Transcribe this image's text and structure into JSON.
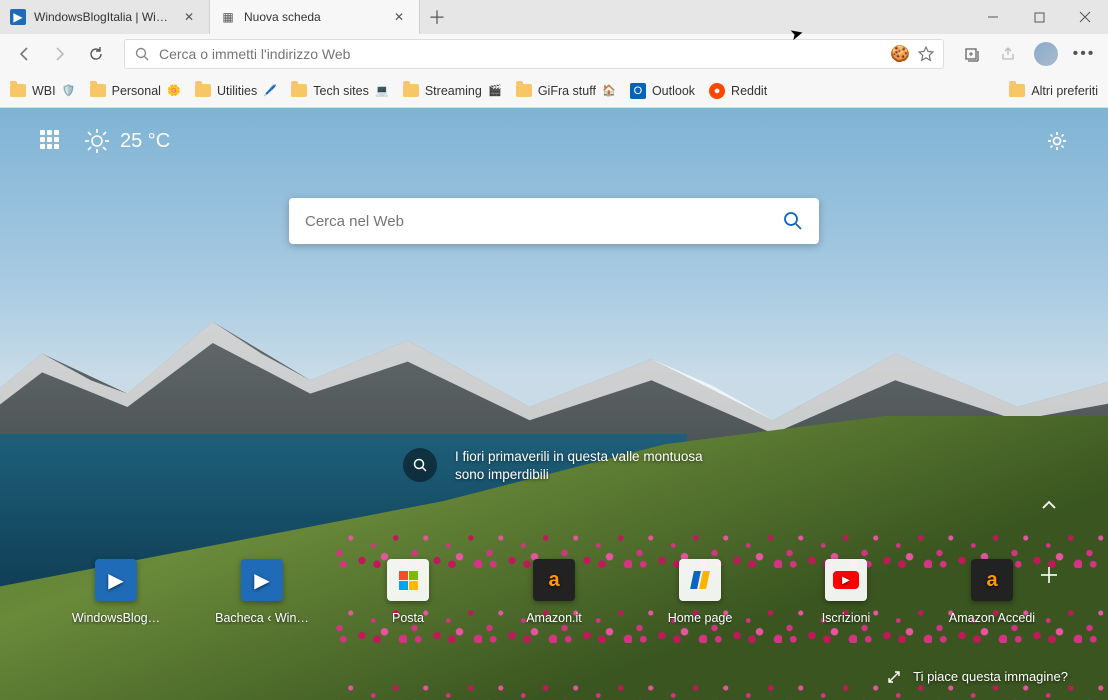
{
  "tabs": [
    {
      "title": "WindowsBlogItalia | Windows, S…",
      "active": false
    },
    {
      "title": "Nuova scheda",
      "active": true
    }
  ],
  "addressbar": {
    "placeholder": "Cerca o immetti l'indirizzo Web"
  },
  "bookmarks": {
    "items": [
      {
        "label": "WBI",
        "deco": "🛡️"
      },
      {
        "label": "Personal",
        "deco": "🌼"
      },
      {
        "label": "Utilities",
        "deco": "🖊️"
      },
      {
        "label": "Tech sites",
        "deco": "💻"
      },
      {
        "label": "Streaming",
        "deco": "🎬"
      },
      {
        "label": "GiFra stuff",
        "deco": "🏠"
      },
      {
        "label": "Outlook"
      },
      {
        "label": "Reddit"
      }
    ],
    "overflow": "Altri preferiti"
  },
  "weather": {
    "temp": "25 °C"
  },
  "search": {
    "placeholder": "Cerca nel Web"
  },
  "caption": {
    "text": "I fiori primaverili in questa valle montuosa sono imperdibili"
  },
  "tiles": [
    {
      "label": "WindowsBlog…",
      "color": "#1f6bb7",
      "glyph": "▶"
    },
    {
      "label": "Bacheca ‹ Win…",
      "color": "#1f6bb7",
      "glyph": "▶"
    },
    {
      "label": "Posta",
      "color": "",
      "glyph": "⊞"
    },
    {
      "label": "Amazon.it",
      "color": "#222",
      "glyph": "a"
    },
    {
      "label": "Home page",
      "color": "#fff",
      "glyph": "◆"
    },
    {
      "label": "Iscrizioni",
      "color": "#fff",
      "glyph": "▶"
    },
    {
      "label": "Amazon Accedi",
      "color": "#222",
      "glyph": "a"
    }
  ],
  "footer": {
    "like": "Ti piace questa immagine?"
  }
}
